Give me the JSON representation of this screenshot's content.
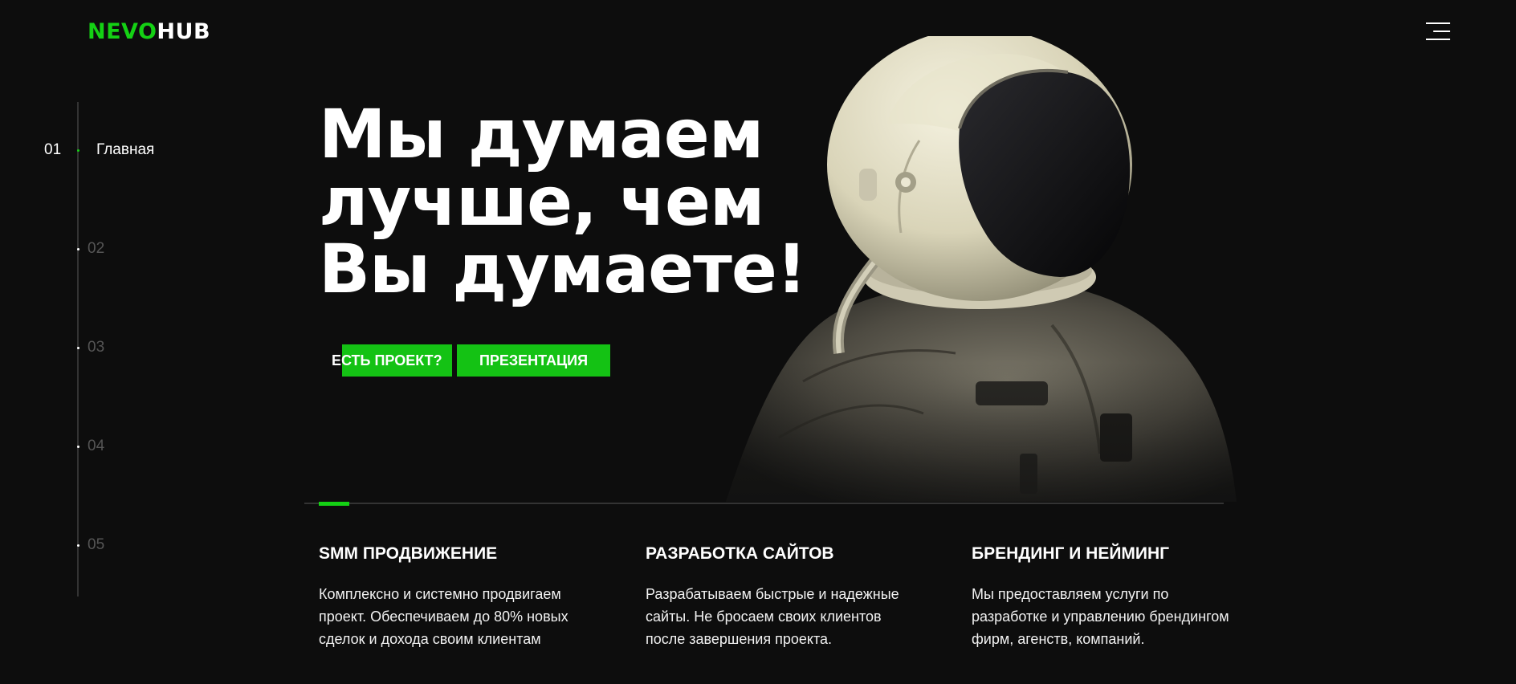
{
  "logo": {
    "part1": "NEVO",
    "part2": "HUB"
  },
  "menu": {
    "icon": "hamburger-menu-icon"
  },
  "nav": {
    "steps": [
      {
        "num": "01",
        "label": "Главная",
        "active": true
      },
      {
        "num": "02",
        "label": "",
        "active": false
      },
      {
        "num": "03",
        "label": "",
        "active": false
      },
      {
        "num": "04",
        "label": "",
        "active": false
      },
      {
        "num": "05",
        "label": "",
        "active": false
      }
    ]
  },
  "hero": {
    "lines": [
      "Мы думаем",
      "лучше, чем",
      "Вы думаете!"
    ],
    "image": "astronaut-illustration",
    "buttons": {
      "project": "ЕСТЬ ПРОЕКТ?",
      "presentation": "ПРЕЗЕНТАЦИЯ"
    }
  },
  "services": [
    {
      "title": "SMM ПРОДВИЖЕНИЕ",
      "lines": [
        "Комплексно и системно продвигаем",
        "проект. Обеспечиваем до 80% новых",
        "сделок и дохода своим клиентам"
      ]
    },
    {
      "title": "РАЗРАБОТКА САЙТОВ",
      "lines": [
        "Разрабатываем быстрые и надежные",
        "сайты. Не бросаем своих клиентов",
        "после завершения проекта."
      ]
    },
    {
      "title": "БРЕНДИНГ И НЕЙМИНГ",
      "lines": [
        "Мы предоставляем услуги по",
        "разработке и управлению брендингом",
        "фирм, агенств, компаний."
      ]
    }
  ],
  "colors": {
    "accent": "#14d114",
    "background": "#0d0d0d",
    "text": "#ffffff",
    "muted": "#555555"
  }
}
